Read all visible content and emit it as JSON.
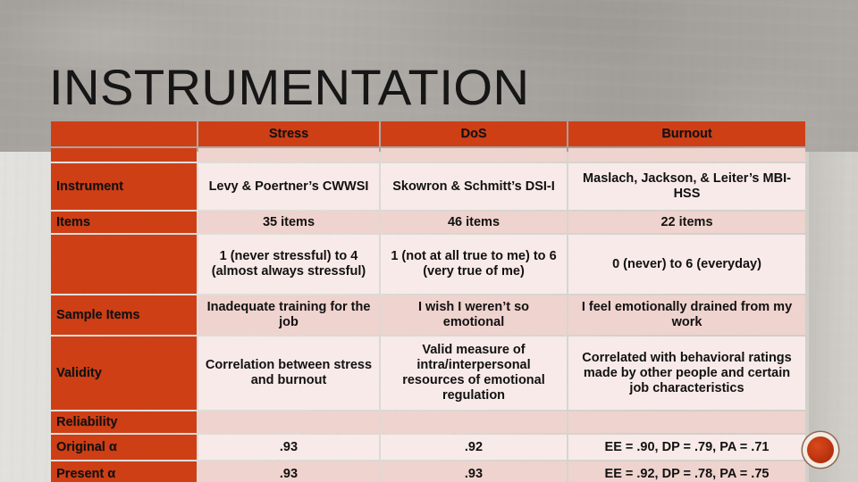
{
  "slide": {
    "title": "INSTRUMENTATION",
    "background_color": "#d2d0cb",
    "accent_color": "#cf3f16",
    "cell_light_color": "#f8eae8",
    "cell_dark_color": "#efd3ce"
  },
  "table": {
    "corner_header": "",
    "columns": [
      "Stress",
      "DoS",
      "Burnout"
    ],
    "rows": [
      {
        "label": "",
        "cells": [
          "",
          "",
          ""
        ]
      },
      {
        "label": "Instrument",
        "cells": [
          "Levy & Poertner’s CWWSI",
          "Skowron & Schmitt’s DSI-I",
          "Maslach, Jackson, & Leiter’s MBI-HSS"
        ]
      },
      {
        "label": "Items",
        "cells": [
          "35 items",
          "46 items",
          "22 items"
        ]
      },
      {
        "label": "",
        "cells": [
          "1 (never stressful) to 4 (almost always stressful)",
          "1 (not at all true to me) to 6 (very true of me)",
          "0 (never) to 6 (everyday)"
        ]
      },
      {
        "label": "Sample Items",
        "cells": [
          "Inadequate training for the job",
          "I wish I weren’t so emotional",
          "I feel emotionally drained from my work"
        ]
      },
      {
        "label": "Validity",
        "cells": [
          "Correlation between stress and burnout",
          "Valid measure of intra/interpersonal resources of emotional regulation",
          "Correlated with behavioral ratings made by other people and certain job characteristics"
        ]
      },
      {
        "label": "Reliability",
        "cells": [
          "",
          "",
          ""
        ]
      },
      {
        "label": "Original α",
        "cells": [
          ".93",
          ".92",
          "EE = .90, DP = .79, PA = .71"
        ]
      },
      {
        "label": "Present α",
        "cells": [
          ".93",
          ".93",
          "EE = .92, DP = .78, PA = .75"
        ]
      }
    ]
  },
  "badge": {
    "name": "decorative-circle-badge",
    "color": "#c4370f"
  }
}
